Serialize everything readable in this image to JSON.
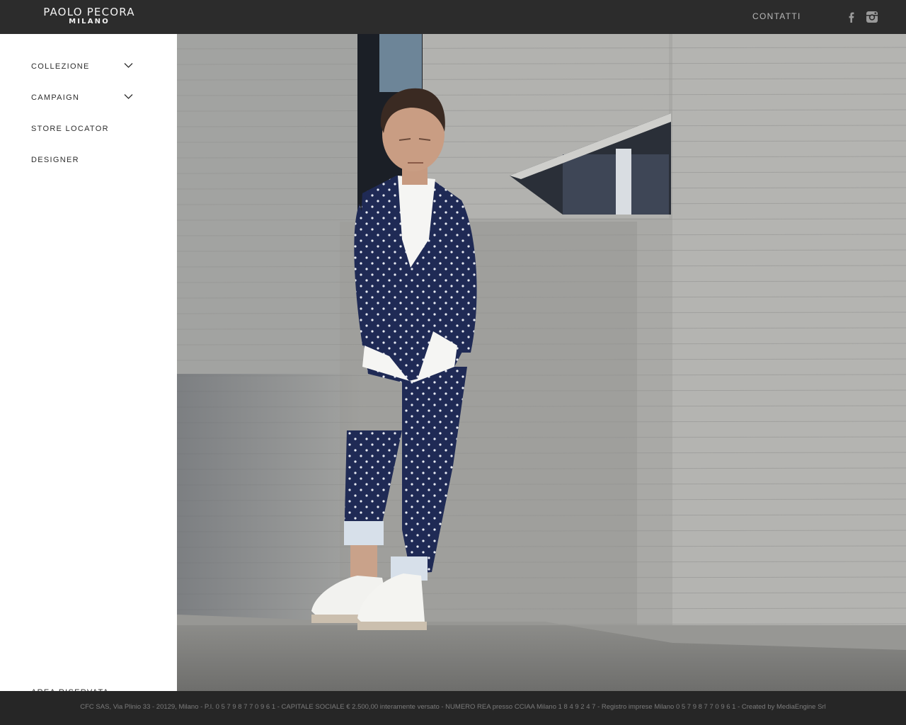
{
  "header": {
    "brand": "PAOLO PECORA",
    "city": "MILANO",
    "contact_label": "CONTATTI",
    "social": [
      {
        "icon": "facebook-icon"
      },
      {
        "icon": "instagram-icon"
      }
    ]
  },
  "sidebar": {
    "items": [
      {
        "label": "COLLEZIONE",
        "expandable": true,
        "icon": "chevron-down-icon"
      },
      {
        "label": "CAMPAIGN",
        "expandable": true,
        "icon": "chevron-down-icon"
      },
      {
        "label": "STORE LOCATOR",
        "expandable": false
      },
      {
        "label": "DESIGNER",
        "expandable": false
      }
    ],
    "reserved_area_label": "AREA RISERVATA"
  },
  "footer": {
    "legal_text": "CFC SAS, Via Plinio 33 - 20129, Milano - P.I. 0 5 7 9 8 7 7 0 9 6 1 - CAPITALE SOCIALE € 2.500,00 interamente versato - NUMERO REA presso CCIAA Milano 1 8 4 9 2 4 7 - Registro imprese Milano 0 5 7 9 8 7 7 0 9 6 1 - Created by MediaEngine Srl"
  },
  "colors": {
    "header_bg": "#2c2c2c",
    "footer_bg": "#262626",
    "suit_navy": "#1f2a55",
    "concrete": "#a6a6a4"
  }
}
